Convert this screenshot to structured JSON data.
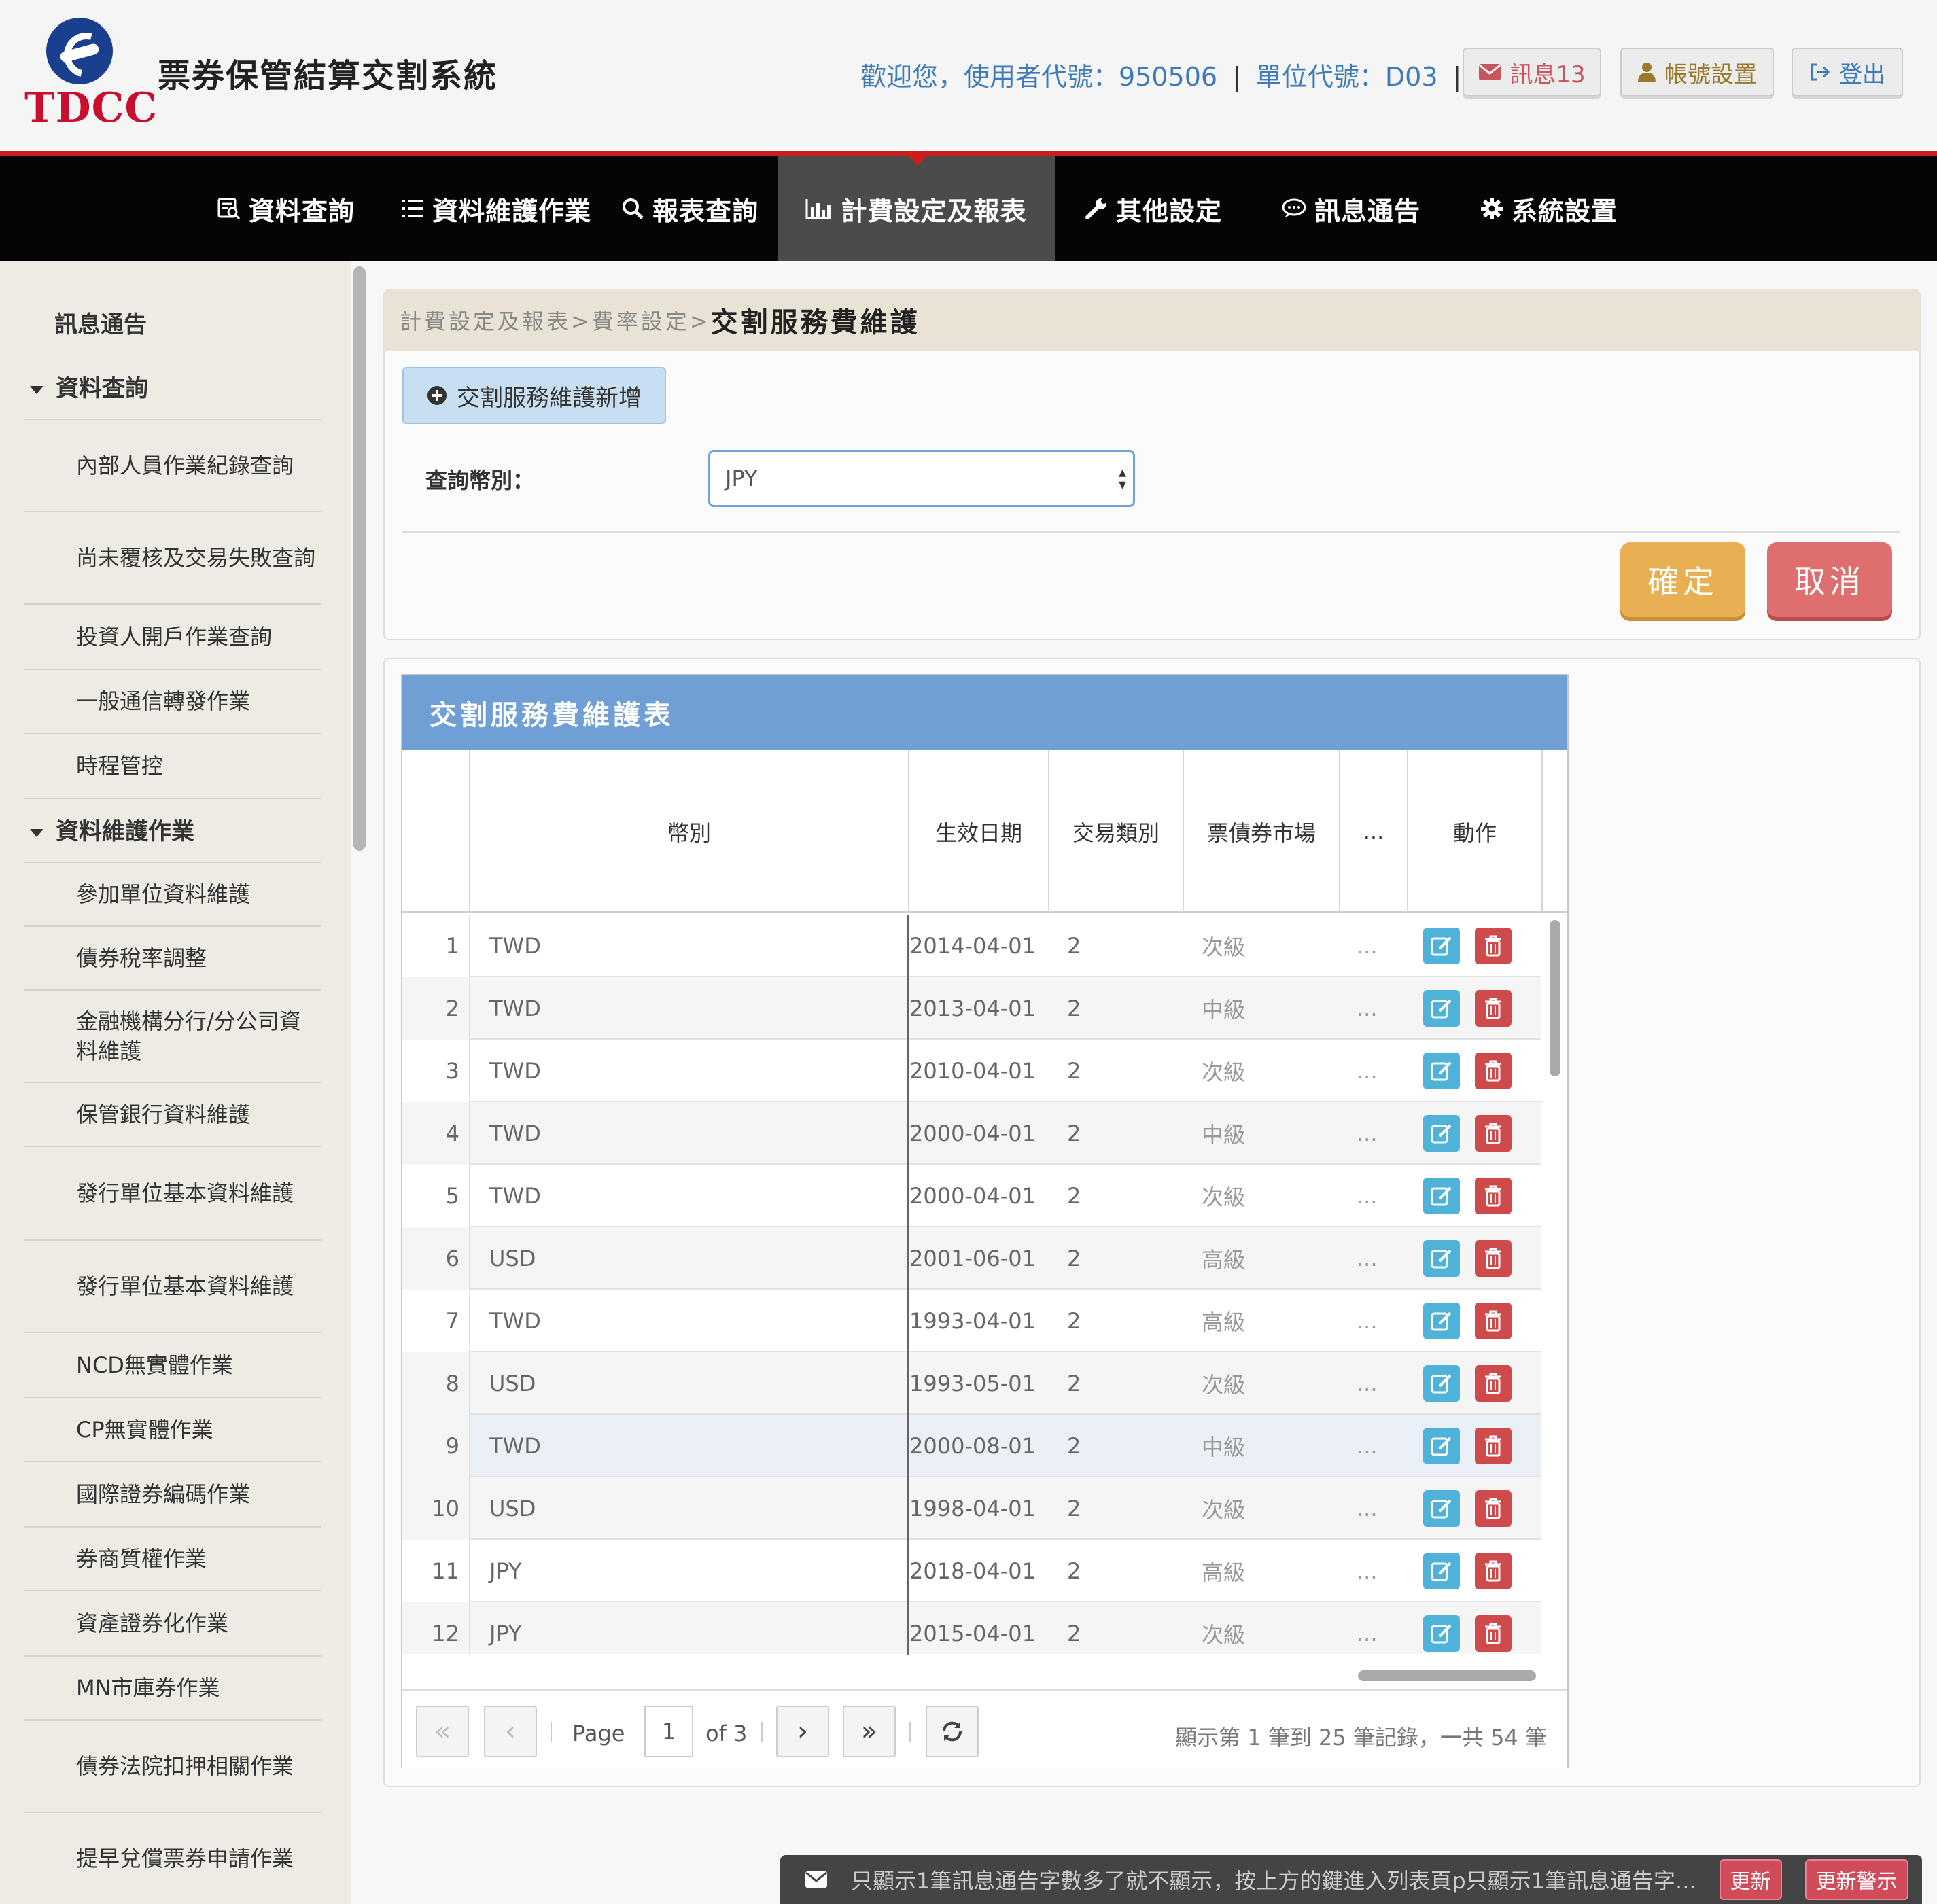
{
  "header": {
    "logo_text": "TDCC",
    "system_title": "票券保管結算交割系統",
    "welcome": "歡迎您，使用者代號：950506",
    "unit": "單位代號：D03",
    "separator": "|",
    "messages_btn": "訊息13",
    "account_btn": "帳號設置",
    "logout_btn": "登出"
  },
  "nav": {
    "items": [
      {
        "label": "資料查詢",
        "icon": "data-query-icon"
      },
      {
        "label": "資料維護作業",
        "icon": "list-icon"
      },
      {
        "label": "報表查詢",
        "icon": "search-icon"
      },
      {
        "label": "計費設定及報表",
        "icon": "bar-chart-icon"
      },
      {
        "label": "其他設定",
        "icon": "wrench-icon"
      },
      {
        "label": "訊息通告",
        "icon": "chat-icon"
      },
      {
        "label": "系統設置",
        "icon": "gear-icon"
      }
    ]
  },
  "sidebar": {
    "top": "訊息通告",
    "group1": "資料查詢",
    "group1_items": [
      "內部人員作業紀錄查詢",
      "尚未覆核及交易失敗查詢",
      "投資人開戶作業查詢",
      "一般通信轉發作業",
      "時程管控"
    ],
    "group2": "資料維護作業",
    "group2_items": [
      "參加單位資料維護",
      "債券稅率調整",
      "金融機構分行/分公司資料維護",
      "保管銀行資料維護",
      "發行單位基本資料維護",
      "發行單位基本資料維護",
      "NCD無實體作業",
      "CP無實體作業",
      "國際證券編碼作業",
      "券商質權作業",
      "資產證券化作業",
      "MN市庫券作業",
      "債券法院扣押相關作業",
      "提早兌償票券申請作業"
    ]
  },
  "breadcrumb": {
    "path": "計費設定及報表>費率設定>",
    "current": "交割服務費維護"
  },
  "form": {
    "add_label": "交割服務維護新增",
    "currency_label": "查詢幣別：",
    "currency_value": "JPY",
    "ok_label": "確定",
    "cancel_label": "取消"
  },
  "grid": {
    "caption": "交割服務費維護表",
    "columns": [
      "幣別",
      "生效日期",
      "交易類別",
      "票債券市場",
      "...",
      "動作"
    ],
    "rows": [
      {
        "n": "1",
        "currency": "TWD",
        "date": "2014-04-01",
        "type": "2",
        "market": "次級",
        "more": "..."
      },
      {
        "n": "2",
        "currency": "TWD",
        "date": "2013-04-01",
        "type": "2",
        "market": "中級",
        "more": "..."
      },
      {
        "n": "3",
        "currency": "TWD",
        "date": "2010-04-01",
        "type": "2",
        "market": "次級",
        "more": "..."
      },
      {
        "n": "4",
        "currency": "TWD",
        "date": "2000-04-01",
        "type": "2",
        "market": "中級",
        "more": "..."
      },
      {
        "n": "5",
        "currency": "TWD",
        "date": "2000-04-01",
        "type": "2",
        "market": "次級",
        "more": "..."
      },
      {
        "n": "6",
        "currency": "USD",
        "date": "2001-06-01",
        "type": "2",
        "market": "高級",
        "more": "..."
      },
      {
        "n": "7",
        "currency": "TWD",
        "date": "1993-04-01",
        "type": "2",
        "market": "高級",
        "more": "..."
      },
      {
        "n": "8",
        "currency": "USD",
        "date": "1993-05-01",
        "type": "2",
        "market": "次級",
        "more": "..."
      },
      {
        "n": "9",
        "currency": "TWD",
        "date": "2000-08-01",
        "type": "2",
        "market": "中級",
        "more": "..."
      },
      {
        "n": "10",
        "currency": "USD",
        "date": "1998-04-01",
        "type": "2",
        "market": "次級",
        "more": "..."
      },
      {
        "n": "11",
        "currency": "JPY",
        "date": "2018-04-01",
        "type": "2",
        "market": "高級",
        "more": "..."
      },
      {
        "n": "12",
        "currency": "JPY",
        "date": "2015-04-01",
        "type": "2",
        "market": "次級",
        "more": "..."
      }
    ],
    "pager": {
      "page_label": "Page",
      "page": "1",
      "of": "of 3",
      "info": "顯示第 1 筆到 25 筆記錄，一共 54 筆"
    }
  },
  "ticker": {
    "text": "只顯示1筆訊息通告字數多了就不顯示，按上方的鍵進入列表頁p只顯示1筆訊息通告字...",
    "update_btn": "更新",
    "update_alert_btn": "更新警示"
  },
  "colors": {
    "brand_red": "#c81e1e",
    "nav_bg": "#050505",
    "grid_caption": "#6f9fd4",
    "ok": "#e8b053",
    "cancel": "#df6f6f"
  }
}
